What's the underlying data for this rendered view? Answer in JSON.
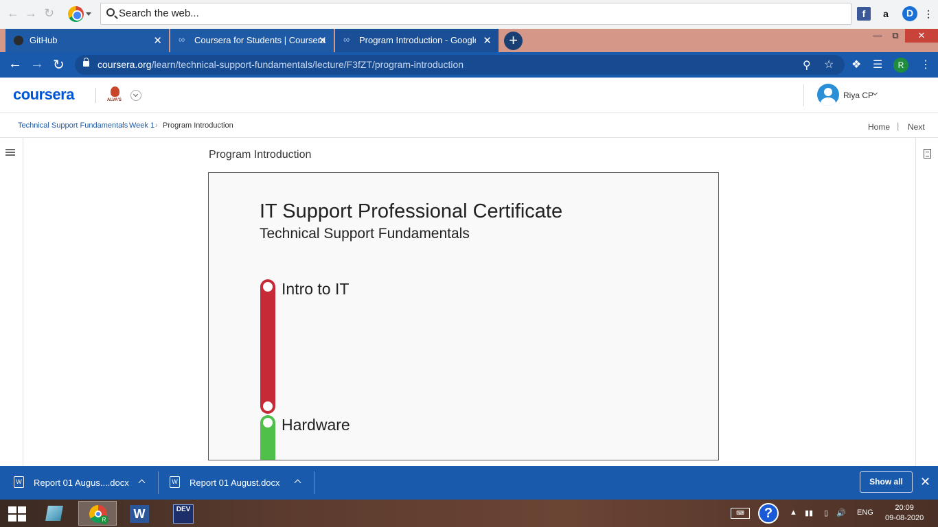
{
  "search": {
    "placeholder": "Search the web..."
  },
  "tabs": [
    {
      "label": "GitHub"
    },
    {
      "label": "Coursera for Students | Coursera"
    },
    {
      "label": "Program Introduction - Google IT"
    }
  ],
  "address": {
    "domain": "coursera.org",
    "path": "/learn/technical-support-fundamentals/lecture/F3fZT/program-introduction",
    "profile_initial": "R"
  },
  "header": {
    "logo": "coursera",
    "partner": "ALVA'S",
    "user_name": "Riya CP"
  },
  "breadcrumb": {
    "course": "Technical Support Fundamentals",
    "week": "Week 1",
    "current": "Program Introduction",
    "home": "Home",
    "next": "Next"
  },
  "lecture": {
    "title": "Program Introduction",
    "slide_title": "IT Support Professional Certificate",
    "slide_subtitle": "Technical Support Fundamentals",
    "steps": [
      {
        "label": "Intro to IT",
        "color": "#c62a36"
      },
      {
        "label": "Hardware",
        "color": "#4fc04a"
      }
    ]
  },
  "downloads": {
    "items": [
      {
        "name": "Report 01 Augus....docx"
      },
      {
        "name": "Report 01 August.docx"
      }
    ],
    "show_all": "Show all"
  },
  "taskbar": {
    "lang": "ENG",
    "time": "20:09",
    "date": "09-08-2020",
    "chrome_badge": "R",
    "dev_label": "DEV"
  },
  "colors": {
    "coursera_blue": "#0056d2",
    "browser_blue": "#1a5aad",
    "tab_strip": "#d49788"
  }
}
